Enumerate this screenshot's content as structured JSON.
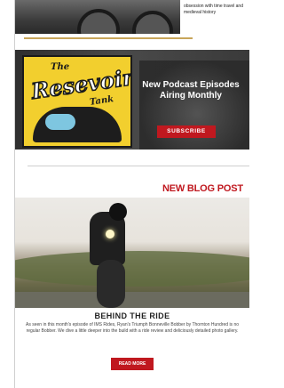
{
  "top_item": {
    "description": "obsession with time travel and medieval history"
  },
  "podcast": {
    "logo_the": "The",
    "logo_name": "Resevoir",
    "logo_tank": "Tank",
    "headline": "New Podcast Episodes Airing Monthly",
    "subscribe_label": "SUBSCRIBE"
  },
  "blog": {
    "heading": "NEW BLOG POST",
    "title": "BEHIND THE RIDE",
    "description": "As seen in this month's episode of IMS Rides, Ryan's Triumph Bonneville Bobber by Thornton Hundred is no regular Bobber. We dive a little deeper into the build with a ride review and deliciously detailed photo gallery.",
    "read_more_label": "READ MORE"
  },
  "colors": {
    "accent_red": "#c0181f",
    "logo_yellow": "#f2cf2e"
  }
}
